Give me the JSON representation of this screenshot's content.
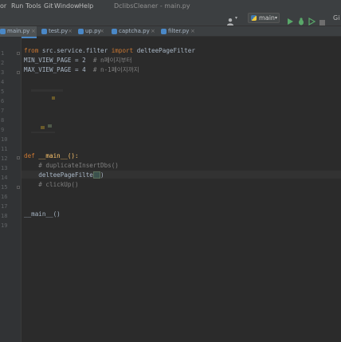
{
  "menu": {
    "items": [
      {
        "label": "or",
        "ul": ""
      },
      {
        "label": "Run",
        "ul": "R"
      },
      {
        "label": "Tools",
        "ul": "T"
      },
      {
        "label": "Git",
        "ul": "G"
      },
      {
        "label": "Window",
        "ul": "W"
      },
      {
        "label": "Help",
        "ul": "H"
      }
    ]
  },
  "window_title": "DcIibsCleaner - main.py",
  "toolbar": {
    "user_icon": "user-icon",
    "run_config": "main",
    "git_label": "Gi"
  },
  "tabs": [
    {
      "label": "main.py"
    },
    {
      "label": "test.py"
    },
    {
      "label": "up.py"
    },
    {
      "label": "captcha.py"
    },
    {
      "label": "filter.py"
    }
  ],
  "code": {
    "l1_from": "from",
    "l1_mod": " src.service.filter ",
    "l1_import": "import",
    "l1_name": " delteePageFilter",
    "l2_code": "MIN_VIEW_PAGE = 2",
    "l2_comment": "  # n페이지부터",
    "l3_code": "MAX_VIEW_PAGE = 4",
    "l3_comment": "  # n-1페이지까지",
    "def_kw": "def",
    "def_sig": " __main__():",
    "body_comment1": "    # duplicateInsertDbs()",
    "body_call": "    delteePageFilter()",
    "body_comment2": "    # clickUp()",
    "call_main": "__main__()"
  },
  "gutter": {
    "numbers": [
      "1",
      "2",
      "3",
      "4",
      "5",
      "6",
      "7",
      "8",
      "9",
      "10",
      "11",
      "12",
      "13",
      "14",
      "15",
      "16",
      "17",
      "18",
      "19"
    ]
  },
  "colors": {
    "accent": "#4a88c7",
    "run_green": "#59a869"
  }
}
